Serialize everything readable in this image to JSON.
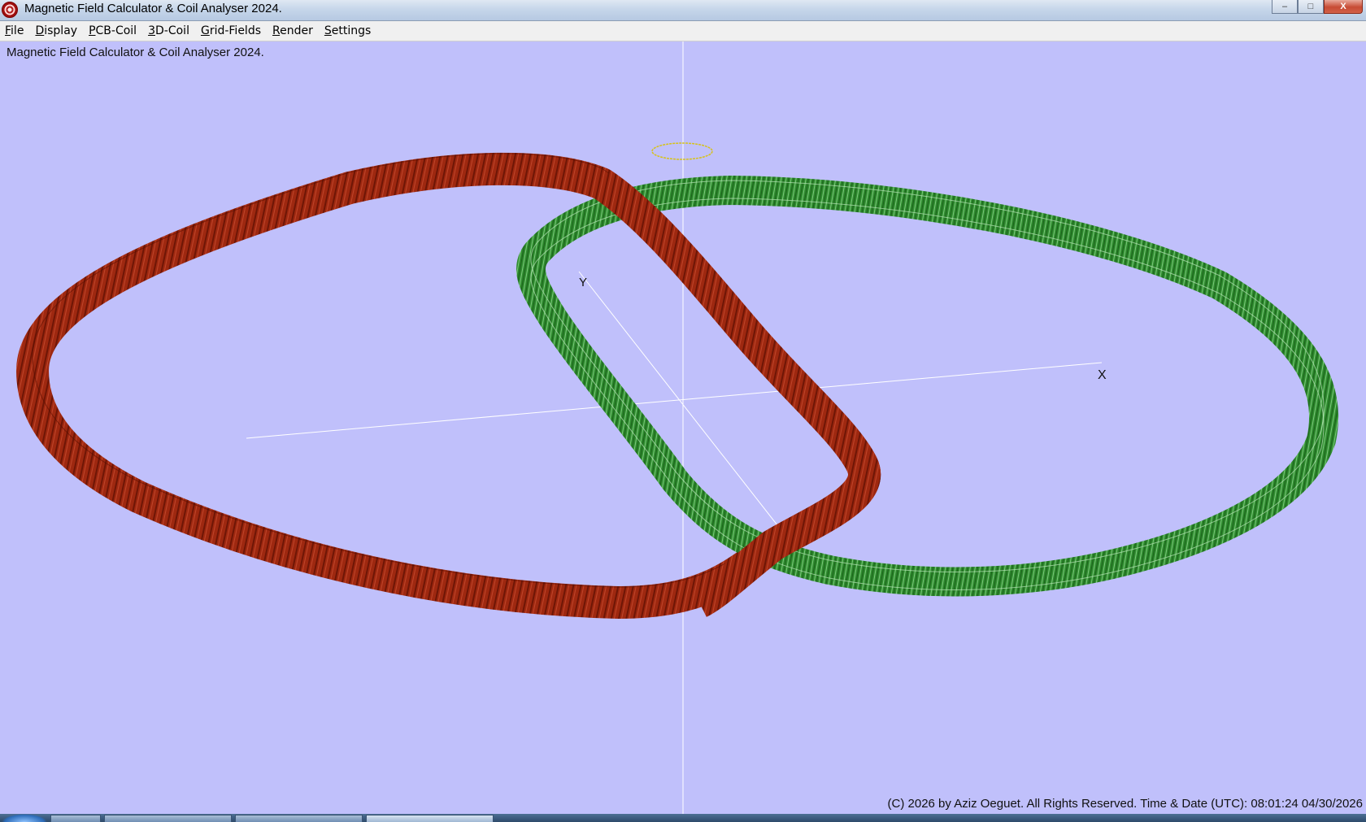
{
  "window": {
    "title": "Magnetic Field Calculator & Coil Analyser 2024.",
    "controls": {
      "minimize": "–",
      "maximize": "□",
      "close": "X"
    }
  },
  "menu": {
    "items": [
      {
        "ul": "F",
        "rest": "ile"
      },
      {
        "ul": "D",
        "rest": "isplay"
      },
      {
        "ul": "P",
        "rest": "CB-Coil"
      },
      {
        "ul": "3",
        "rest": "D-Coil"
      },
      {
        "ul": "G",
        "rest": "rid-Fields"
      },
      {
        "ul": "R",
        "rest": "ender"
      },
      {
        "ul": "S",
        "rest": "ettings"
      }
    ]
  },
  "viewport": {
    "caption": "Magnetic Field Calculator & Coil Analyser 2024.",
    "axis_labels": {
      "x": "X",
      "y": "Y"
    },
    "footer": "(C) 2026  by Aziz Oeguet. All Rights Reserved.  Time & Date (UTC): 08:01:24  04/30/2026",
    "colors": {
      "background": "#c0c0fb",
      "red_coil": "#9e2810",
      "green_coil": "#2e8b2e",
      "axis": "#ffffff",
      "marker": "#d6c21a"
    }
  },
  "taskbar": {
    "start_icon": "windows-orb-icon"
  }
}
